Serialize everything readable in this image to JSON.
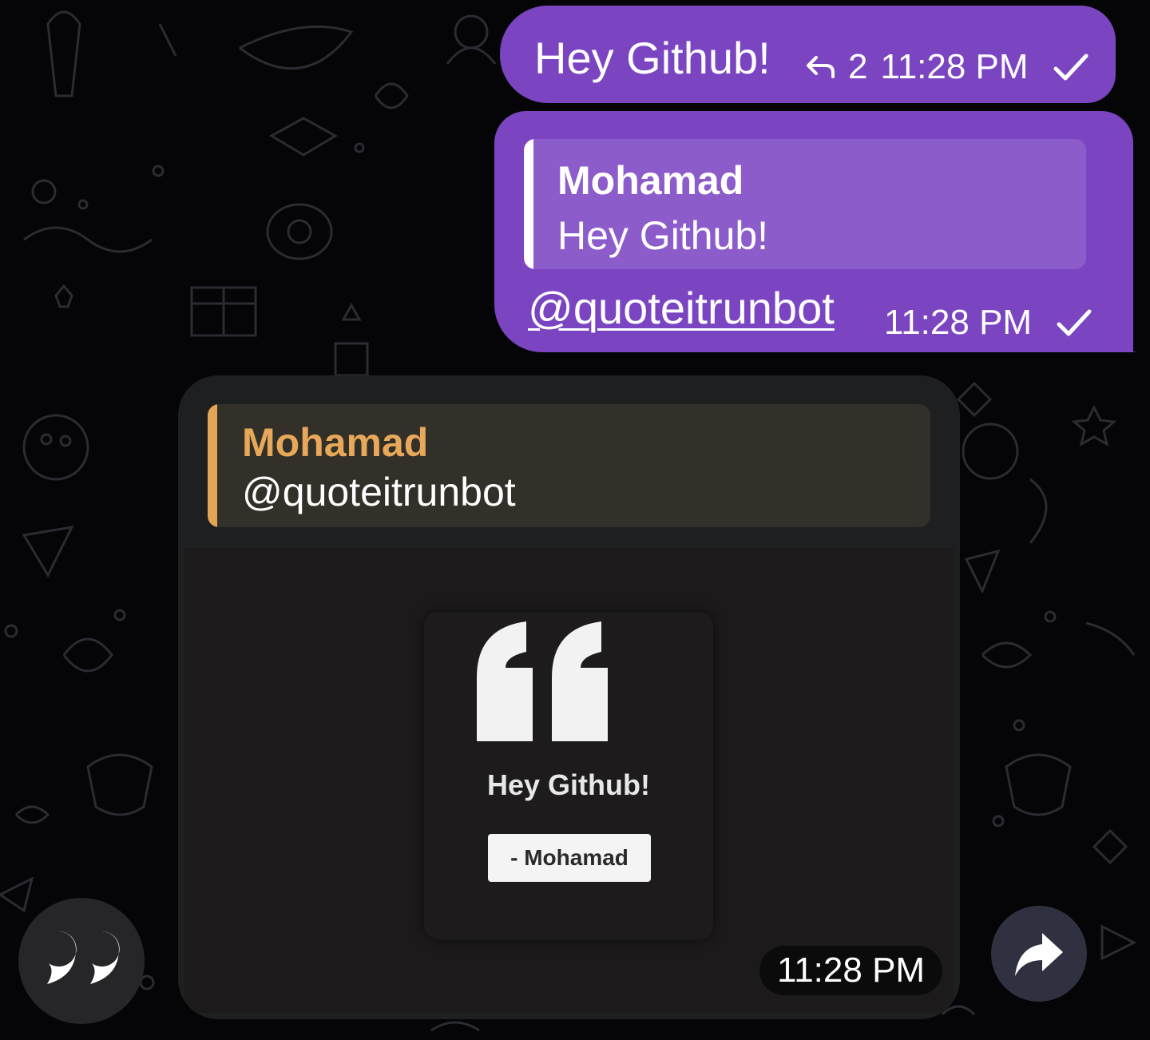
{
  "chat": {
    "outgoing_message": {
      "text": "Hey Github!",
      "reply_count": "2",
      "time": "11:28 PM",
      "status_icon": "check-icon"
    },
    "outgoing_reply": {
      "quoted_author": "Mohamad",
      "quoted_text": "Hey Github!",
      "mention": "@quoteitrunbot",
      "time": "11:28 PM",
      "status_icon": "check-icon"
    },
    "bot_reply": {
      "quoted_author": "Mohamad",
      "quoted_text": "@quoteitrunbot",
      "image": {
        "quote_text": "Hey Github!",
        "author": "- Mohamad",
        "icon": "quote-mark-icon"
      },
      "time": "11:28 PM"
    }
  },
  "controls": {
    "quote_button_icon": "quote-icon",
    "forward_button_icon": "forward-icon"
  },
  "colors": {
    "background": "#050507",
    "outgoing_bubble": "#7b45c2",
    "outgoing_quote": "#8d5ccb",
    "incoming_bubble": "#1e1f21",
    "reply_accent": "#e5a557",
    "reply_author": "#e8a85a"
  }
}
